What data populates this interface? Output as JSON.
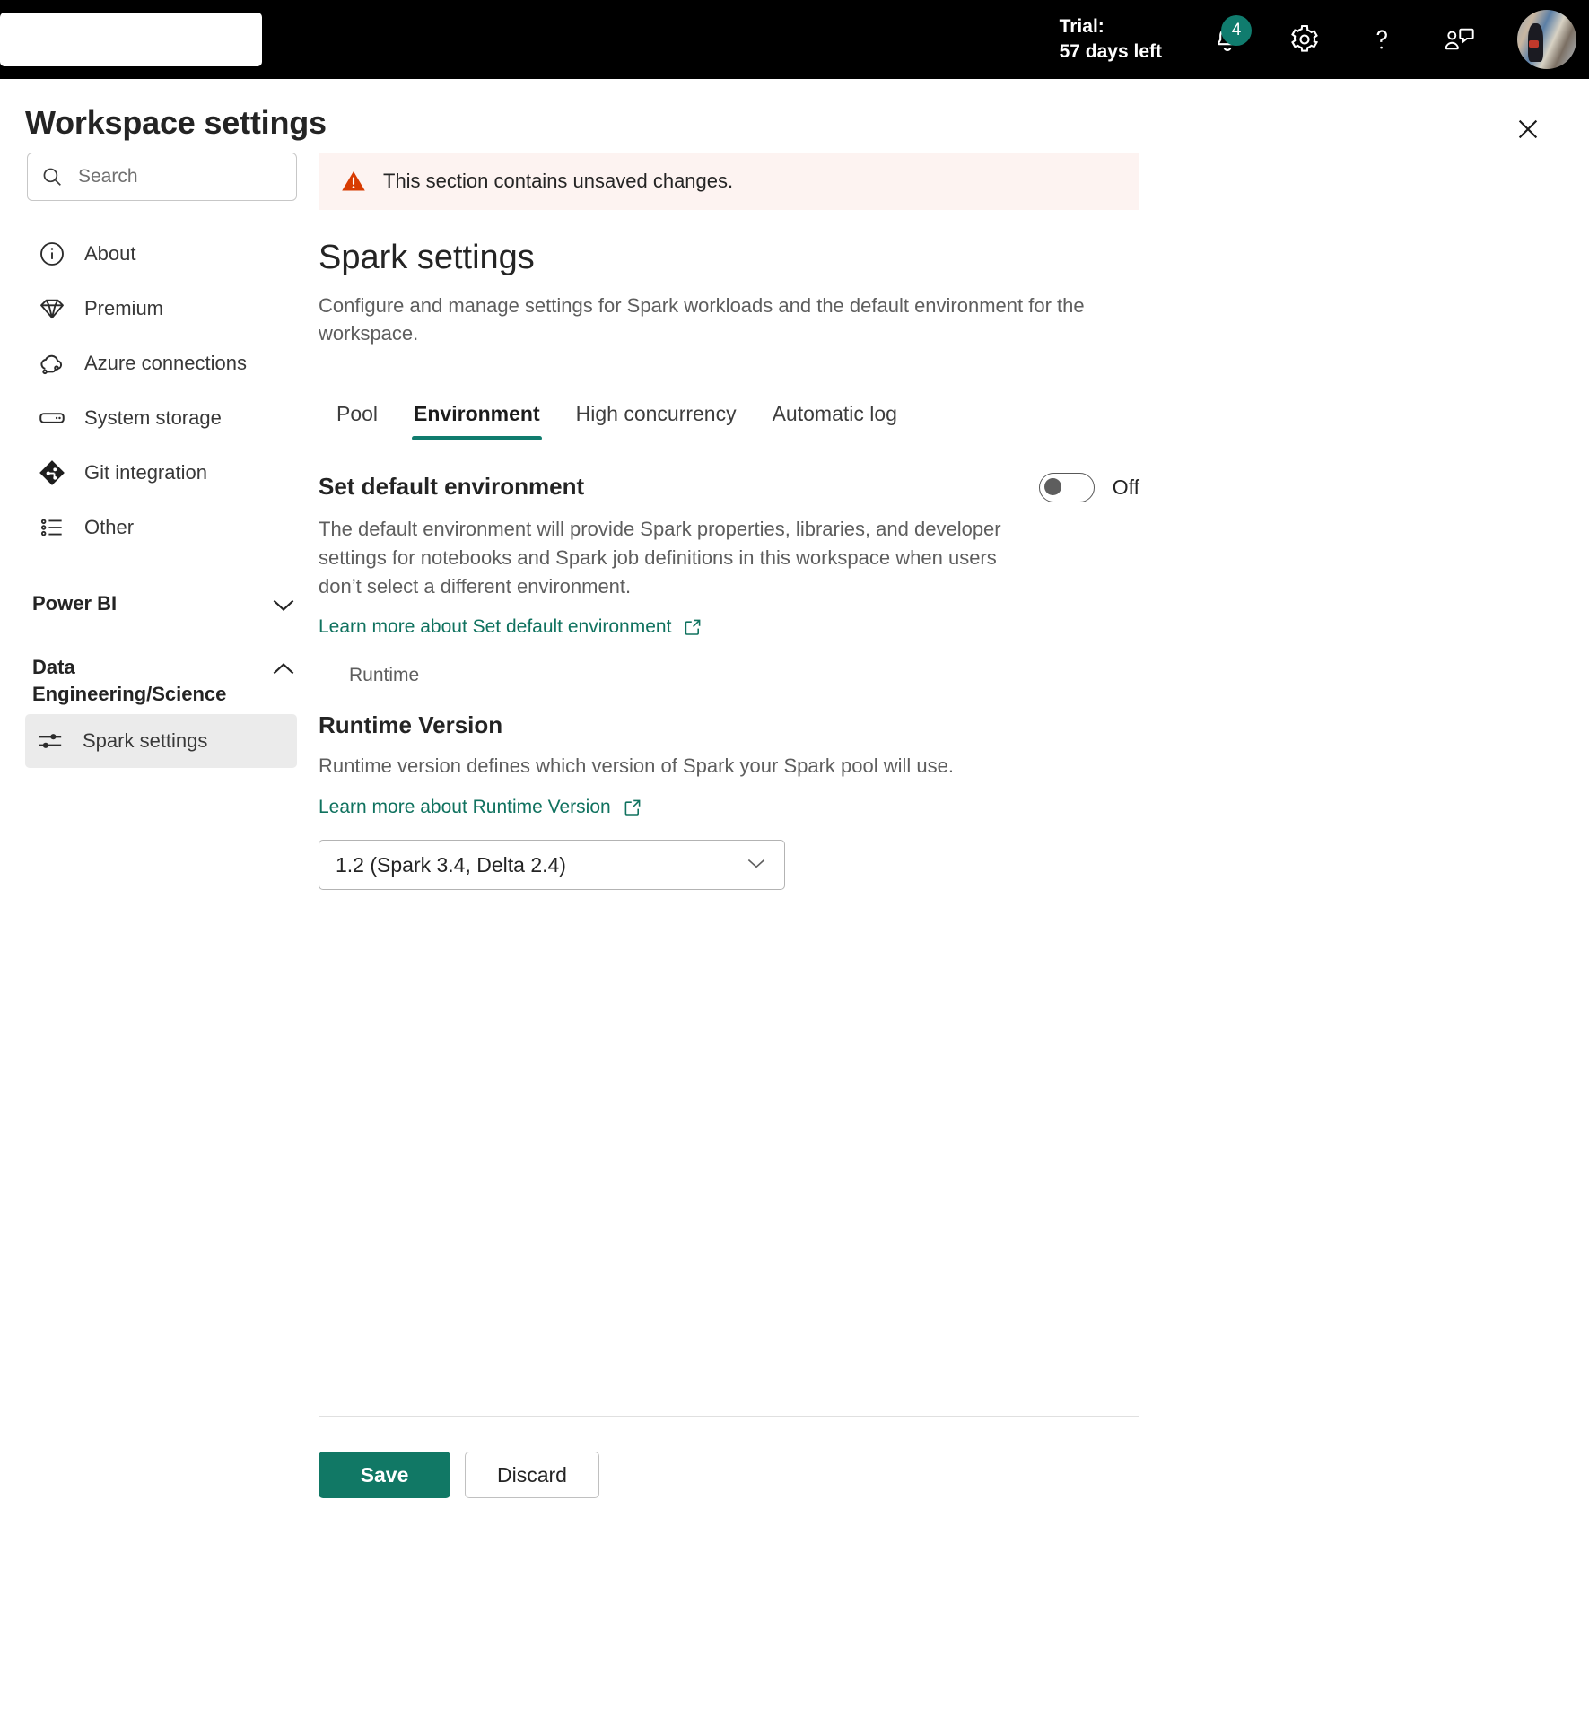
{
  "topbar": {
    "search_placeholder": "",
    "trial_line1": "Trial:",
    "trial_line2": "57 days left",
    "notification_count": "4",
    "icons": {
      "bell": "notifications-icon",
      "gear": "settings-gear-icon",
      "help": "help-question-icon",
      "feedback": "feedback-icon",
      "avatar": "user-avatar"
    },
    "accent_color": "#107c6e"
  },
  "panel": {
    "title": "Workspace settings",
    "close_label": "Close"
  },
  "sidebar": {
    "search": {
      "placeholder": "Search",
      "value": ""
    },
    "items": [
      {
        "label": "About",
        "icon": "info-icon"
      },
      {
        "label": "Premium",
        "icon": "diamond-icon"
      },
      {
        "label": "Azure connections",
        "icon": "cloud-link-icon"
      },
      {
        "label": "System storage",
        "icon": "storage-icon"
      },
      {
        "label": "Git integration",
        "icon": "git-icon"
      },
      {
        "label": "Other",
        "icon": "list-icon"
      }
    ],
    "groups": [
      {
        "title": "Power BI",
        "expanded": false,
        "chevron": "chevron-down-icon",
        "children": []
      },
      {
        "title": "Data Engineering/Science",
        "expanded": true,
        "chevron": "chevron-up-icon",
        "children": [
          {
            "label": "Spark settings",
            "icon": "sliders-icon",
            "selected": true
          }
        ]
      }
    ]
  },
  "main": {
    "banner": {
      "text": "This section contains unsaved changes.",
      "icon": "warning-triangle-icon",
      "bg": "#fdf3f1",
      "icon_color": "#d83b01"
    },
    "heading": "Spark settings",
    "description": "Configure and manage settings for Spark workloads and the default environment for the workspace.",
    "tabs": [
      {
        "label": "Pool",
        "active": false
      },
      {
        "label": "Environment",
        "active": true
      },
      {
        "label": "High concurrency",
        "active": false
      },
      {
        "label": "Automatic log",
        "active": false
      }
    ],
    "default_env": {
      "title": "Set default environment",
      "toggle_state": "Off",
      "toggle_on": false,
      "description": "The default environment will provide Spark properties, libraries, and developer settings for notebooks and Spark job definitions in this workspace when users don’t select a different environment.",
      "learn_more": "Learn more about Set default environment",
      "learn_more_icon": "external-link-icon"
    },
    "runtime_divider": "Runtime",
    "runtime": {
      "title": "Runtime Version",
      "description": "Runtime version defines which version of Spark your Spark pool will use.",
      "learn_more": "Learn more about Runtime Version",
      "learn_more_icon": "external-link-icon",
      "selected": "1.2 (Spark 3.4, Delta 2.4)",
      "chevron": "chevron-down-icon"
    },
    "actions": {
      "save": "Save",
      "discard": "Discard",
      "save_color": "#117865"
    }
  }
}
